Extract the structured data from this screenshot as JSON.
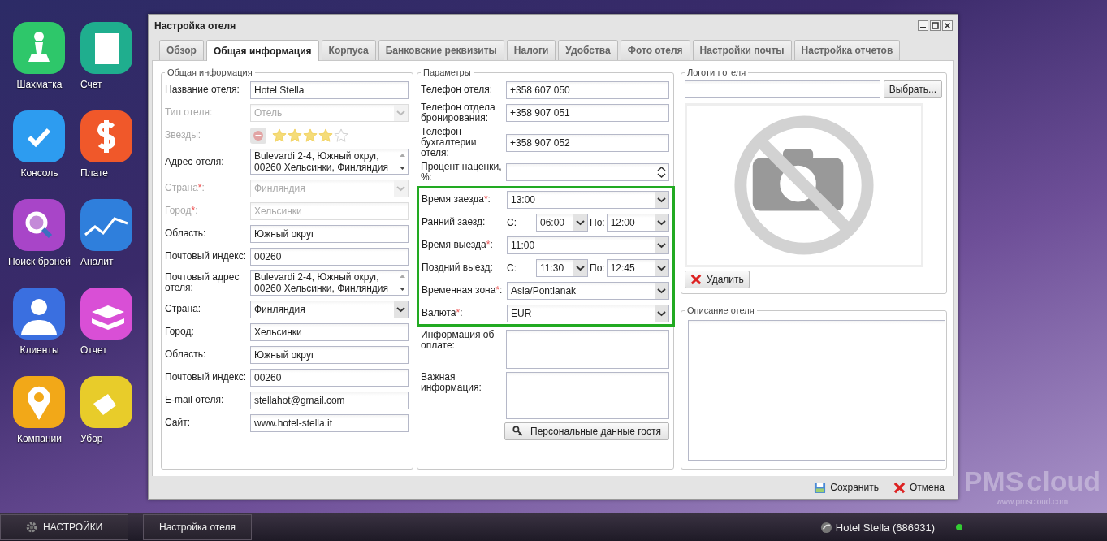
{
  "desktop_icons": [
    {
      "label": "Шахматка",
      "color": "#2ec76a"
    },
    {
      "label": "Счет",
      "color": "#1fae8e"
    },
    {
      "label": "Консоль",
      "color": "#2d9cf0"
    },
    {
      "label": "Плате",
      "color": "#f0582a"
    },
    {
      "label": "Поиск броней",
      "color": "#a845c8"
    },
    {
      "label": "Аналит",
      "color": "#2f7fdc"
    },
    {
      "label": "Клиенты",
      "color": "#3a6fe0"
    },
    {
      "label": "Отчет",
      "color": "#d94fd6"
    },
    {
      "label": "Компании",
      "color": "#f2a818"
    },
    {
      "label": "Убор",
      "color": "#e8cc2a"
    }
  ],
  "branding": {
    "logo_left": "PMS",
    "logo_right": "cloud",
    "url": "www.pmscloud.com"
  },
  "window": {
    "title": "Настройка отеля",
    "tabs": [
      {
        "label": "Обзор",
        "selected": false
      },
      {
        "label": "Общая информация",
        "selected": true
      },
      {
        "label": "Корпуса",
        "selected": false
      },
      {
        "label": "Банковские реквизиты",
        "selected": false
      },
      {
        "label": "Налоги",
        "selected": false
      },
      {
        "label": "Удобства",
        "selected": false
      },
      {
        "label": "Фото отеля",
        "selected": false
      },
      {
        "label": "Настройки почты",
        "selected": false
      },
      {
        "label": "Настройка отчетов",
        "selected": false
      }
    ],
    "general": {
      "legend": "Общая информация",
      "fields": [
        {
          "label": "Название отеля:",
          "kind": "text",
          "value": "Hotel Stella",
          "disabled": false
        },
        {
          "label": "Тип отеля:",
          "kind": "select",
          "value": "Отель",
          "disabled": true
        },
        {
          "label": "Звезды:",
          "kind": "stars",
          "stars": 4,
          "disabled": true
        },
        {
          "label": "Адрес отеля:",
          "kind": "textarea",
          "value": "Bulevardi 2-4, Южный округ, 00260 Хельсинки, Финляндия",
          "disabled": false
        },
        {
          "label": "Страна",
          "required_mark": "*",
          "label_end": ":",
          "kind": "select",
          "value": "Финляндия",
          "disabled": true
        },
        {
          "label": "Город",
          "required_mark": "*",
          "label_end": ":",
          "kind": "text",
          "value": "Хельсинки",
          "disabled": true
        },
        {
          "label": "Область:",
          "kind": "text",
          "value": "Южный округ",
          "disabled": false
        },
        {
          "label": "Почтовый индекс:",
          "kind": "text",
          "value": "00260",
          "disabled": false
        },
        {
          "label": "Почтовый адрес отеля:",
          "kind": "textarea",
          "value": "Bulevardi 2-4, Южный округ, 00260 Хельсинки, Финляндия",
          "disabled": false
        },
        {
          "label": "Страна:",
          "kind": "select",
          "value": "Финляндия",
          "disabled": false
        },
        {
          "label": "Город:",
          "kind": "text",
          "value": "Хельсинки",
          "disabled": false
        },
        {
          "label": "Область:",
          "kind": "text",
          "value": "Южный округ",
          "disabled": false
        },
        {
          "label": "Почтовый индекс:",
          "kind": "text",
          "value": "00260",
          "disabled": false
        },
        {
          "label": "E-mail отеля:",
          "kind": "text",
          "value": "stellahot@gmail.com",
          "disabled": false
        },
        {
          "label": "Сайт:",
          "kind": "text",
          "value": "www.hotel-stella.it",
          "disabled": false
        }
      ]
    },
    "params": {
      "legend": "Параметры",
      "fields": [
        {
          "label": "Телефон отеля:",
          "kind": "text",
          "value": "+358 607 050"
        },
        {
          "label": "Телефон отдела бронирования:",
          "kind": "text",
          "value": "+358 907 051"
        },
        {
          "label": "Телефон бухгалтерии отеля:",
          "kind": "text",
          "value": "+358 907 052"
        },
        {
          "label": "Процент наценки, %:",
          "kind": "spinner"
        }
      ],
      "highlighted_fields": [
        {
          "label": "Время заезда",
          "required_mark": "*",
          "label_end": ":",
          "kind": "select",
          "value": "13:00"
        },
        {
          "label": "Ранний заезд:",
          "kind": "range",
          "from_label": "С:",
          "from": "06:00",
          "to_label": "По:",
          "to": "12:00"
        },
        {
          "label": "Время выезда",
          "required_mark": "*",
          "label_end": ":",
          "kind": "select",
          "value": "11:00"
        },
        {
          "label": "Поздний выезд:",
          "kind": "range",
          "from_label": "С:",
          "from": "11:30",
          "to_label": "По:",
          "to": "12:45"
        },
        {
          "label": "Временная зона",
          "required_mark": "*",
          "label_end": ":",
          "kind": "select",
          "value": "Asia/Pontianak"
        },
        {
          "label": "Валюта",
          "required_mark": "*",
          "label_end": ":",
          "kind": "select",
          "value": "EUR"
        }
      ],
      "fields_after": [
        {
          "label": "Информация об оплате:",
          "kind": "textarea"
        },
        {
          "label": "Важная информация:",
          "kind": "textarea_tall"
        }
      ],
      "button": "Персональные данные гостя"
    },
    "logo": {
      "legend": "Логотип отеля",
      "browse_button": "Выбрать...",
      "delete_button": "Удалить"
    },
    "description": {
      "legend": "Описание отеля"
    },
    "footer_buttons": [
      {
        "label": "Сохранить",
        "kind": "save"
      },
      {
        "label": "Отмена",
        "kind": "cancel"
      }
    ]
  },
  "taskbar": {
    "start": "НАСТРОЙКИ",
    "tasks": [
      {
        "label": "Настройка отеля"
      }
    ],
    "hotel": "Hotel Stella (686931)",
    "online": true
  }
}
